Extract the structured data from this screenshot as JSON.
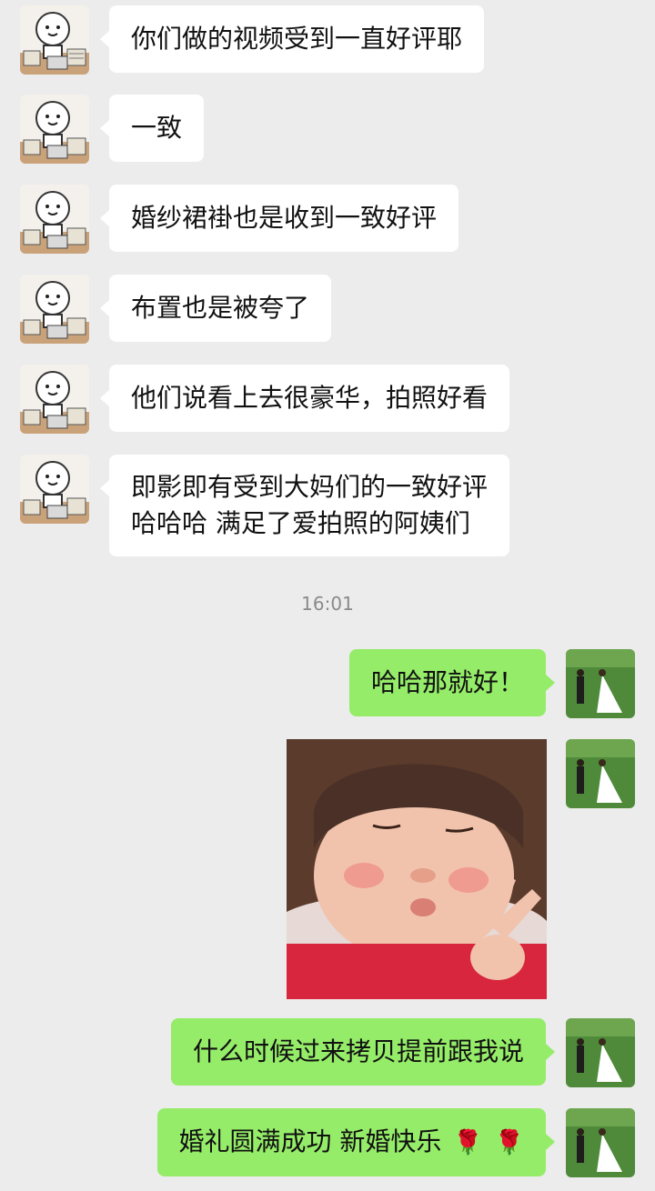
{
  "chat": {
    "messages_left": [
      {
        "text": "你们做的视频受到一直好评耶"
      },
      {
        "text": "一致"
      },
      {
        "text": "婚纱裙褂也是收到一致好评"
      },
      {
        "text": "布置也是被夸了"
      },
      {
        "text": "他们说看上去很豪华，拍照好看"
      },
      {
        "line1": "即影即有受到大妈们的一致好评",
        "line2": "哈哈哈 满足了爱拍照的阿姨们"
      }
    ],
    "timestamp": "16:01",
    "messages_right": [
      {
        "text": "哈哈那就好！"
      },
      {
        "text": "什么时候过来拷贝提前跟我说"
      },
      {
        "text": "婚礼圆满成功 新婚快乐",
        "emoji": [
          "rose-emoji",
          "rose-emoji"
        ]
      }
    ],
    "sticker": {
      "icon": "girl-peace-sign-sticker"
    },
    "colors": {
      "background": "#ececec",
      "incoming_bubble": "#ffffff",
      "outgoing_bubble": "#95ec69"
    }
  }
}
